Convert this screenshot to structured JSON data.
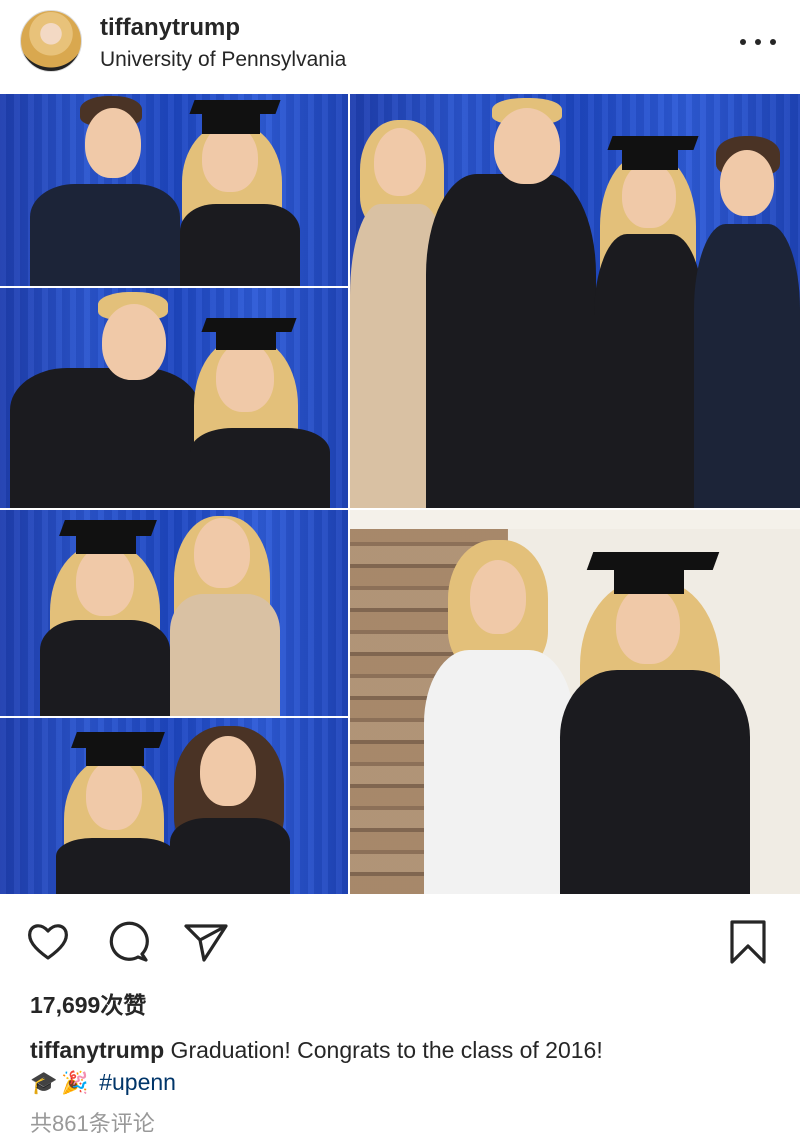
{
  "post": {
    "username": "tiffanytrump",
    "location": "University of Pennsylvania",
    "likes_text": "17,699次赞",
    "caption_username": "tiffanytrump",
    "caption_text": " Graduation! Congrats to the class of 2016!",
    "caption_emoji_1": "🎓",
    "caption_emoji_2": "🎉",
    "hashtag": "#upenn",
    "comments_text": "共861条评论"
  },
  "icons": {
    "more": "more-options-icon",
    "like": "heart-icon",
    "comment": "comment-bubble-icon",
    "share": "paper-plane-icon",
    "save": "bookmark-icon"
  },
  "colors": {
    "text": "#262626",
    "hashtag": "#003569",
    "muted": "#999999",
    "backdrop_blue": "#2a55cf"
  }
}
